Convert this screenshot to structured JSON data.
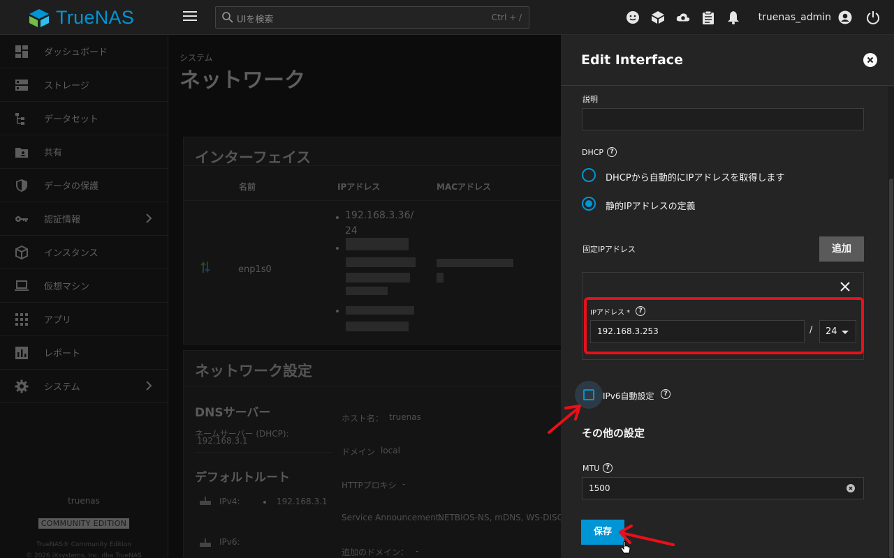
{
  "topbar": {
    "brand": "TrueNAS",
    "search_placeholder": "UIを検索",
    "search_shortcut": "Ctrl + /",
    "username": "truenas_admin",
    "icons": [
      "feedback-icon",
      "truecommand-icon",
      "cloud-icon",
      "clipboard-icon",
      "bell-icon",
      "account-icon",
      "power-icon"
    ]
  },
  "sidebar": {
    "items": [
      {
        "label": "ダッシュボード",
        "icon": "dashboard-icon"
      },
      {
        "label": "ストレージ",
        "icon": "storage-icon"
      },
      {
        "label": "データセット",
        "icon": "dataset-icon"
      },
      {
        "label": "共有",
        "icon": "share-icon"
      },
      {
        "label": "データの保護",
        "icon": "shield-icon"
      },
      {
        "label": "認証情報",
        "icon": "key-icon",
        "chevron": true
      },
      {
        "label": "インスタンス",
        "icon": "cube-icon"
      },
      {
        "label": "仮想マシン",
        "icon": "laptop-icon"
      },
      {
        "label": "アプリ",
        "icon": "apps-icon"
      },
      {
        "label": "レポート",
        "icon": "chart-icon"
      },
      {
        "label": "システム",
        "icon": "gear-icon",
        "chevron": true
      }
    ],
    "hostname": "truenas",
    "edition": "COMMUNITY EDITION",
    "copyright": "TrueNAS® Community Edition",
    "copyright2": "© 2026 iXsystems, Inc. dba TrueNAS"
  },
  "main": {
    "breadcrumb": "システム",
    "title": "ネットワーク",
    "interfaces": {
      "title": "インターフェイス",
      "col_name": "名前",
      "col_ip": "IPアドレス",
      "col_mac": "MACアドレス",
      "row_name": "enp1s0",
      "row_ip1": "192.168.3.36/",
      "row_ip1b": "24"
    },
    "netconf": {
      "title": "ネットワーク設定",
      "dns_title": "DNSサーバー",
      "ns_label": "ネームサーバー (DHCP):",
      "ns_value": "192.168.3.1",
      "route_title": "デフォルトルート",
      "ipv4_label": "IPv4:",
      "ipv4_value": "192.168.3.1",
      "ipv6_label": "IPv6:",
      "hostname_label": "ホスト名：",
      "hostname_value": "truenas",
      "domain_label": "ドメイン",
      "domain_value": "local",
      "proxy_label": "HTTPプロキシ",
      "proxy_value": "-",
      "service_label": "Service Announcement:",
      "service_value": "NETBIOS-NS, mDNS, WS-DISCO",
      "extra_label": "追加のドメイン：",
      "extra_value": "-"
    }
  },
  "drawer": {
    "title": "Edit Interface",
    "desc_label": "説明",
    "desc_value": "",
    "dhcp_label": "DHCP",
    "dhcp_option": "DHCPから自動的にIPアドレスを取得します",
    "static_option": "静的IPアドレスの定義",
    "dhcp_selected": "static",
    "alias_label": "固定IPアドレス",
    "add_label": "追加",
    "ip_label": "IPアドレス *",
    "ip_value": "192.168.3.253",
    "slash": "/",
    "netmask": "24",
    "ipv6_auto_label": "IPv6自動設定",
    "ipv6_auto_checked": false,
    "other_title": "その他の設定",
    "mtu_label": "MTU",
    "mtu_value": "1500",
    "save_label": "保存",
    "help_glyph": "?"
  },
  "colors": {
    "accent": "#0095d5",
    "annotation": "#e8101a"
  }
}
